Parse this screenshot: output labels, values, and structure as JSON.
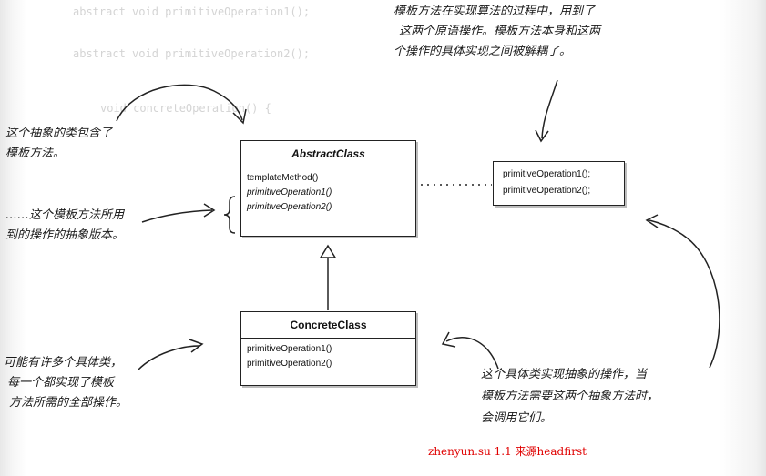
{
  "diagram": {
    "abstract_class": {
      "name": "AbstractClass",
      "operations": [
        "templateMethod()",
        "primitiveOperation1()",
        "primitiveOperation2()"
      ]
    },
    "concrete_class": {
      "name": "ConcreteClass",
      "operations": [
        "primitiveOperation1()",
        "primitiveOperation2()"
      ]
    },
    "code_note": {
      "lines": [
        "primitiveOperation1();",
        "primitiveOperation2();"
      ]
    }
  },
  "annotations": {
    "top_right": [
      "模板方法在实现算法的过程中，用到了",
      "这两个原语操作。模板方法本身和这两",
      "个操作的具体实现之间被解耦了。"
    ],
    "left_top": [
      "这个抽象的类包含了",
      "模板方法。"
    ],
    "left_middle": [
      "……这个模板方法所用",
      "到的操作的抽象版本。"
    ],
    "left_bottom": [
      "可能有许多个具体类，",
      "每一个都实现了模板",
      "方法所需的全部操作。"
    ],
    "right_bottom": [
      "这个具体类实现抽象的操作，当",
      "模板方法需要这两个抽象方法时，",
      "会调用它们。"
    ]
  },
  "footer": "zhenyun.su 1.1 来源headfirst"
}
